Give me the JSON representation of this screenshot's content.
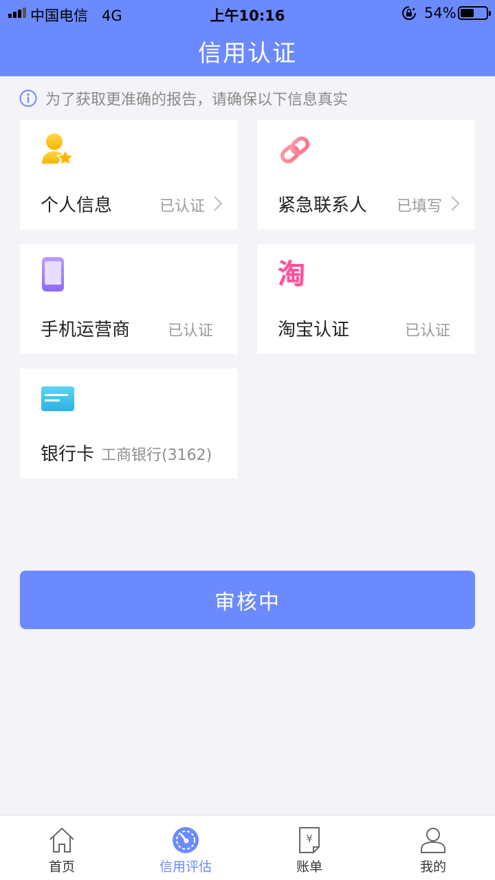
{
  "status_bar": {
    "carrier": "中国电信",
    "network": "4G",
    "time": "上午10:16",
    "battery": "54%",
    "battery_level": 0.54
  },
  "header": {
    "title": "信用认证"
  },
  "notice": {
    "text": "为了获取更准确的报告，请确保以下信息真实",
    "icon": "info-icon"
  },
  "cards": {
    "personal": {
      "label": "个人信息",
      "status": "已认证",
      "icon": "user-star-icon"
    },
    "emergency": {
      "label": "紧急联系人",
      "status": "已填写",
      "icon": "link-icon"
    },
    "mobile": {
      "label": "手机运营商",
      "status": "已认证",
      "icon": "phone-icon"
    },
    "taobao": {
      "label": "淘宝认证",
      "status": "已认证",
      "icon": "taobao-icon",
      "glyph": "淘"
    },
    "bank": {
      "label": "银行卡",
      "sub": "工商银行(3162)",
      "icon": "bank-card-icon"
    }
  },
  "button": {
    "label": "审核中"
  },
  "tabbar": {
    "items": [
      {
        "label": "首页",
        "icon": "home-icon"
      },
      {
        "label": "信用评估",
        "icon": "gauge-icon",
        "active": true
      },
      {
        "label": "账单",
        "icon": "bill-icon"
      },
      {
        "label": "我的",
        "icon": "user-icon"
      }
    ]
  },
  "colors": {
    "brand": "#6b8afe",
    "background": "#f4f3f7"
  }
}
